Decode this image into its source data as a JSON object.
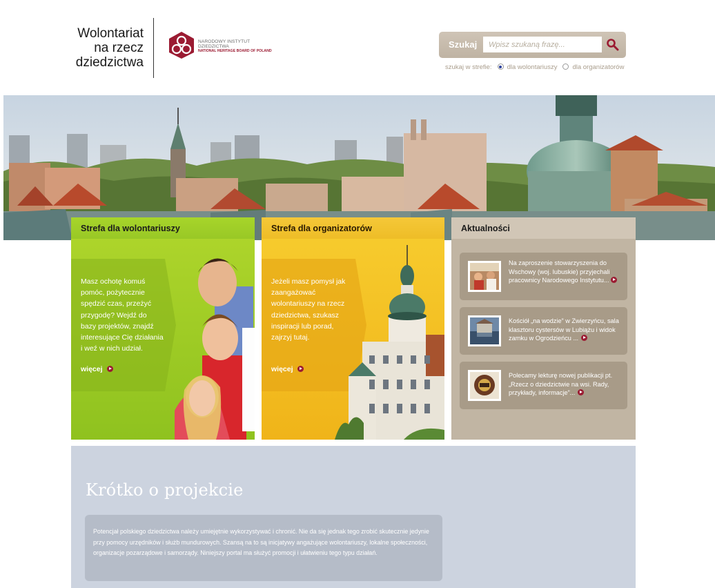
{
  "header": {
    "site_title_lines": [
      "Wolontariat",
      "na rzecz",
      "dziedzictwa"
    ],
    "institute": {
      "line1": "NARODOWY INSTYTUT",
      "line2": "DZIEDZICTWA",
      "line3": "NATIONAL HERITAGE BOARD OF POLAND"
    }
  },
  "search": {
    "label": "Szukaj",
    "placeholder": "Wpisz szukaną frazę...",
    "button_icon": "search-icon",
    "zone_label": "szukaj w strefie:",
    "zone_options": [
      {
        "label": "dla wolontariuszy",
        "selected": true
      },
      {
        "label": "dla organizatorów",
        "selected": false
      }
    ]
  },
  "volunteers": {
    "heading": "Strefa dla wolontariuszy",
    "text": "Masz ochotę komuś pomóc, pożytecznie spędzić czas, przeżyć przygodę? Wejdź do bazy projektów, znajdź interesujące Cię działania i weź w nich udział.",
    "more": "więcej"
  },
  "organizers": {
    "heading": "Strefa dla organizatorów",
    "text": "Jeżeli masz pomysł jak zaangażować wolontariuszy na rzecz dziedzictwa, szukasz inspiracji lub porad, zajrzyj tutaj.",
    "more": "więcej"
  },
  "news": {
    "heading": "Aktualności",
    "items": [
      {
        "text": "Na zaproszenie stowarzyszenia do Wschowy (woj. lubuskie) przyjechali pracownicy Narodowego Instytutu..."
      },
      {
        "text": "Kościół „na wodzie” w Zwierzyńcu, sala klasztoru cystersów w Lubiążu i widok zamku w Ogrodzieńcu ..."
      },
      {
        "text": "Polecamy lekturę nowej publikacji pt. „Rzecz o dziedzictwie na wsi. Rady, przykłady, informacje”..."
      }
    ]
  },
  "about": {
    "title": "Krótko o projekcie",
    "text": "Potencjał polskiego dziedzictwa należy umiejętnie wykorzystywać i chronić. Nie da się jednak tego zrobić skutecznie jedynie przy pomocy urzędników i służb mundurowych. Szansą na to są inicjatywy angażujące wolontariuszy, lokalne społeczności, organizacje pozarządowe i samorządy. Niniejszy portal ma służyć promocji i ułatwieniu tego typu działań."
  },
  "colors": {
    "brand_red": "#9b1b32",
    "green": "#9acb25",
    "yellow": "#f3c125",
    "taupe": "#c1b5a3",
    "about_bg": "#ccd3df"
  }
}
